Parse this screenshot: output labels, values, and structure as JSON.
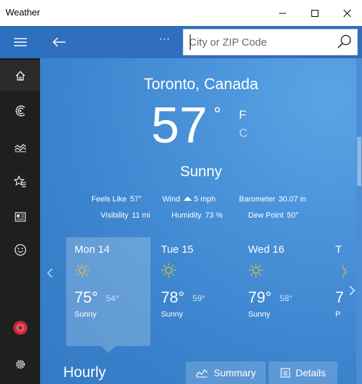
{
  "window": {
    "title": "Weather",
    "minimize": "—",
    "maximize": "☐",
    "close": "✕"
  },
  "sidebar": {
    "items": [
      {
        "icon": "hamburger-icon"
      },
      {
        "icon": "home-icon"
      },
      {
        "icon": "radar-icon"
      },
      {
        "icon": "historical-chart-icon"
      },
      {
        "icon": "favorites-icon"
      },
      {
        "icon": "news-icon"
      },
      {
        "icon": "smiley-icon"
      },
      {
        "icon": "flower-avatar-icon"
      },
      {
        "icon": "settings-icon"
      }
    ]
  },
  "toolbar": {
    "back": "←",
    "more": "···",
    "search": {
      "placeholder": "City or ZIP Code"
    }
  },
  "current": {
    "city": "Toronto, Canada",
    "temp": "57",
    "degree": "°",
    "unit_f": "F",
    "unit_c": "C",
    "condition": "Sunny",
    "details": {
      "feels_like_label": "Feels Like",
      "feels_like": "57°",
      "wind_label": "Wind",
      "wind": "5 mph",
      "barometer_label": "Barometer",
      "barometer": "30.07 in",
      "visibility_label": "Visibility",
      "visibility": "11 mi",
      "humidity_label": "Humidity",
      "humidity": "73 %",
      "dew_point_label": "Dew Point",
      "dew_point": "50°"
    }
  },
  "forecast": {
    "days": [
      {
        "day": "Mon 14",
        "high": "75°",
        "low": "54°",
        "condition": "Sunny"
      },
      {
        "day": "Tue 15",
        "high": "78°",
        "low": "59°",
        "condition": "Sunny"
      },
      {
        "day": "Wed 16",
        "high": "79°",
        "low": "58°",
        "condition": "Sunny"
      },
      {
        "day": "T",
        "high": "7",
        "low": "",
        "condition": "P"
      }
    ]
  },
  "bottom": {
    "hourly": "Hourly",
    "summary": "Summary",
    "details": "Details"
  },
  "colors": {
    "accent": "#2b6fbf",
    "sidebar": "#1f1f1f",
    "sun": "#f2c230",
    "background": "#3a82cc"
  }
}
